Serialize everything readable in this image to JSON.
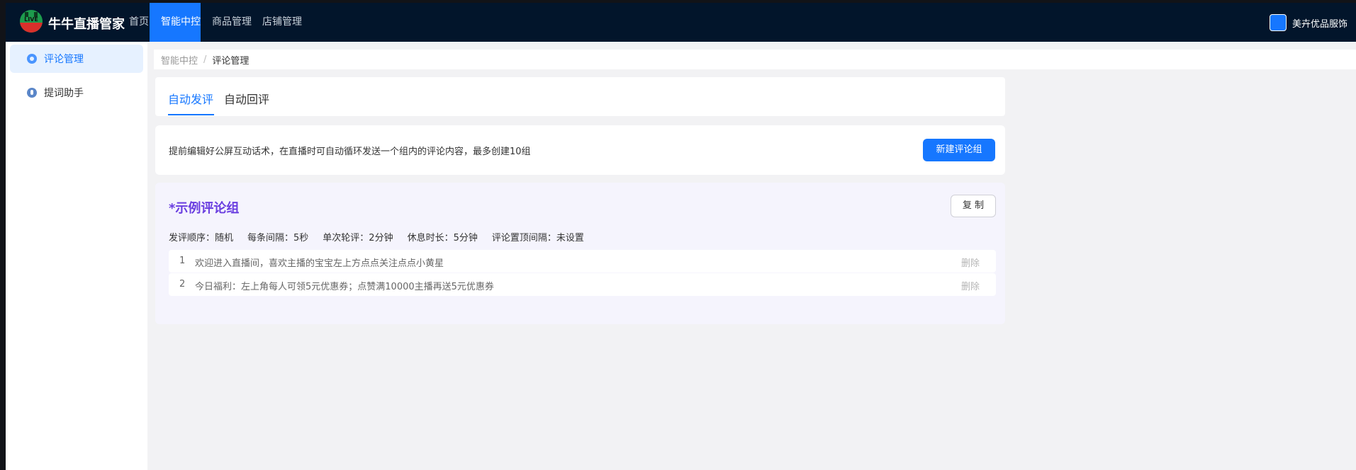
{
  "app": {
    "brand": "牛牛直播管家",
    "logo_text": "LIVE"
  },
  "nav": {
    "items": [
      "首页",
      "智能中控",
      "商品管理",
      "店铺管理"
    ],
    "active_index": 1
  },
  "store": {
    "name": "美卉优品服饰",
    "avatar_color": "#1677ff"
  },
  "sidebar": {
    "items": [
      {
        "label": "评论管理",
        "active": true
      },
      {
        "label": "提词助手",
        "active": false
      }
    ]
  },
  "breadcrumb": {
    "parent": "智能中控",
    "separator": "/",
    "current": "评论管理"
  },
  "tabs": {
    "items": [
      "自动发评",
      "自动回评"
    ],
    "active_index": 0
  },
  "info": {
    "text": "提前编辑好公屏互动话术，在直播时可自动循环发送一个组内的评论内容，最多创建10组",
    "new_button": "新建评论组"
  },
  "group": {
    "title": "*示例评论组",
    "copy_button": "复 制",
    "meta": {
      "order": "发评顺序：随机",
      "interval": "每条间隔：5秒",
      "round": "单次轮评：2分钟",
      "rest": "休息时长：5分钟",
      "pin": "评论置顶间隔：未设置"
    },
    "comments": [
      {
        "num": "1",
        "text": "欢迎进入直播间，喜欢主播的宝宝左上方点点关注点点小黄星",
        "delete": "删除"
      },
      {
        "num": "2",
        "text": "今日福利：左上角每人可领5元优惠券；点赞满10000主播再送5元优惠券",
        "delete": "删除"
      }
    ]
  },
  "colors": {
    "primary": "#1677ff",
    "topbar": "#02152b",
    "group_title": "#6a3ee0"
  }
}
